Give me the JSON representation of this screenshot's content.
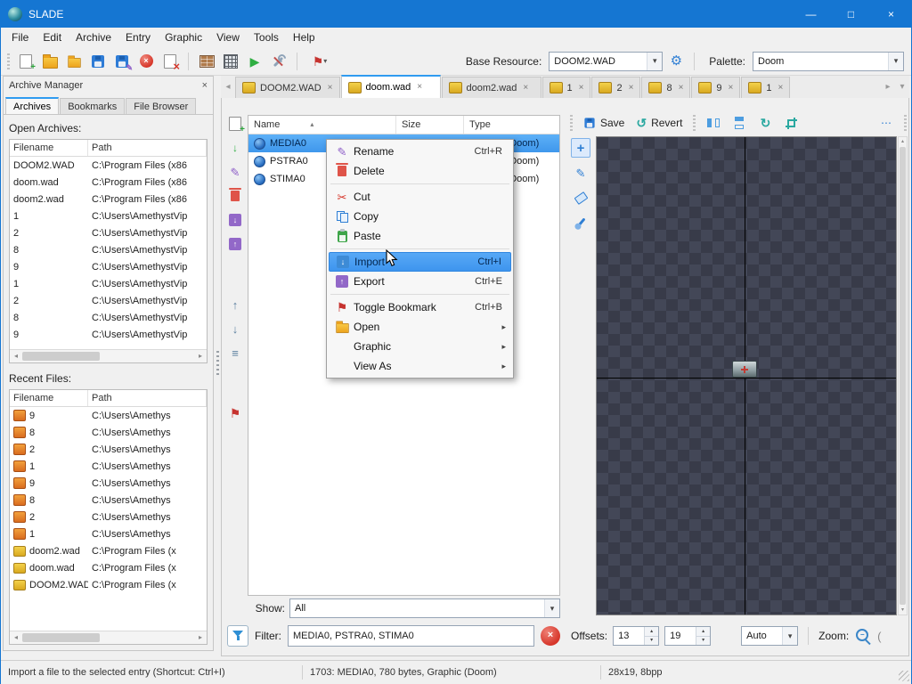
{
  "window": {
    "title": "SLADE"
  },
  "glyphs": {
    "minimize": "—",
    "maximize": "□",
    "close": "×",
    "plus": "+",
    "minus": "−",
    "pencil": "✎",
    "scissors": "✂",
    "flag": "⚑",
    "gear": "⚙",
    "play": "▶",
    "arrow_up": "↑",
    "arrow_down": "↓",
    "sort": "≡",
    "rotate_ccw": "↺",
    "rotate_cw": "↻",
    "dots_h": "⋯",
    "chevron_left": "◂",
    "chevron_right": "▸",
    "chevron_down": "▾",
    "spin_up": "▴",
    "spin_down": "▾",
    "paren": "("
  },
  "colors": {
    "titlebar": "#1576d2",
    "accent": "#2f9bf0",
    "selection": "#3f97ec",
    "canvas_dark": "#383b49",
    "canvas_light": "#434757"
  },
  "menubar": [
    "File",
    "Edit",
    "Archive",
    "Entry",
    "Graphic",
    "View",
    "Tools",
    "Help"
  ],
  "toolbar": {
    "base_resource_label": "Base Resource:",
    "base_resource_value": "DOOM2.WAD",
    "palette_label": "Palette:",
    "palette_value": "Doom"
  },
  "tabbar": {
    "tabs": [
      {
        "label": "DOOM2.WAD"
      },
      {
        "label": "doom.wad"
      },
      {
        "label": "doom2.wad"
      },
      {
        "label": "1"
      },
      {
        "label": "2"
      },
      {
        "label": "8"
      },
      {
        "label": "9"
      },
      {
        "label": "1"
      }
    ]
  },
  "archive_manager": {
    "title": "Archive Manager",
    "tabs": [
      "Archives",
      "Bookmarks",
      "File Browser"
    ],
    "open_archives_label": "Open Archives:",
    "recent_files_label": "Recent Files:",
    "list_headers": [
      "Filename",
      "Path"
    ],
    "open_archives": [
      {
        "name": "DOOM2.WAD",
        "path": "C:\\Program Files (x86"
      },
      {
        "name": "doom.wad",
        "path": "C:\\Program Files (x86"
      },
      {
        "name": "doom2.wad",
        "path": "C:\\Program Files (x86"
      },
      {
        "name": "1",
        "path": "C:\\Users\\AmethystVip"
      },
      {
        "name": "2",
        "path": "C:\\Users\\AmethystVip"
      },
      {
        "name": "8",
        "path": "C:\\Users\\AmethystVip"
      },
      {
        "name": "9",
        "path": "C:\\Users\\AmethystVip"
      },
      {
        "name": "1",
        "path": "C:\\Users\\AmethystVip"
      },
      {
        "name": "2",
        "path": "C:\\Users\\AmethystVip"
      },
      {
        "name": "8",
        "path": "C:\\Users\\AmethystVip"
      },
      {
        "name": "9",
        "path": "C:\\Users\\AmethystVip"
      }
    ],
    "recent_files": [
      {
        "name": "9",
        "path": "C:\\Users\\Amethys"
      },
      {
        "name": "8",
        "path": "C:\\Users\\Amethys"
      },
      {
        "name": "2",
        "path": "C:\\Users\\Amethys"
      },
      {
        "name": "1",
        "path": "C:\\Users\\Amethys"
      },
      {
        "name": "9",
        "path": "C:\\Users\\Amethys"
      },
      {
        "name": "8",
        "path": "C:\\Users\\Amethys"
      },
      {
        "name": "2",
        "path": "C:\\Users\\Amethys"
      },
      {
        "name": "1",
        "path": "C:\\Users\\Amethys"
      },
      {
        "name": "doom2.wad",
        "path": "C:\\Program Files (x"
      },
      {
        "name": "doom.wad",
        "path": "C:\\Program Files (x"
      },
      {
        "name": "DOOM2.WAD",
        "path": "C:\\Program Files (x"
      }
    ]
  },
  "entry_list": {
    "headers": {
      "name": "Name",
      "size": "Size",
      "type": "Type"
    },
    "rows": [
      {
        "name": "MEDIA0",
        "type": "Graphic (Doom)"
      },
      {
        "name": "PSTRA0",
        "type": "Graphic (Doom)"
      },
      {
        "name": "STIMA0",
        "type": "Graphic (Doom)"
      }
    ],
    "show_label": "Show:",
    "show_value": "All",
    "filter_label": "Filter:",
    "filter_value": "MEDIA0, PSTRA0, STIMA0"
  },
  "context_menu": {
    "rename": {
      "label": "Rename",
      "shortcut": "Ctrl+R"
    },
    "delete": {
      "label": "Delete"
    },
    "cut": {
      "label": "Cut"
    },
    "copy": {
      "label": "Copy"
    },
    "paste": {
      "label": "Paste"
    },
    "import": {
      "label": "Import",
      "shortcut": "Ctrl+I"
    },
    "export": {
      "label": "Export",
      "shortcut": "Ctrl+E"
    },
    "toggle_bookmark": {
      "label": "Toggle Bookmark",
      "shortcut": "Ctrl+B"
    },
    "open": {
      "label": "Open"
    },
    "graphic": {
      "label": "Graphic"
    },
    "view_as": {
      "label": "View As"
    }
  },
  "gfx": {
    "save_label": "Save",
    "revert_label": "Revert",
    "offsets_label": "Offsets:",
    "offset_x": "13",
    "offset_y": "19",
    "offset_type": "Auto",
    "zoom_label": "Zoom:"
  },
  "statusbar": {
    "help": "Import a file to the selected entry (Shortcut: Ctrl+I)",
    "entry_info": "1703: MEDIA0, 780 bytes, Graphic (Doom)",
    "gfx_info": "28x19, 8bpp"
  }
}
